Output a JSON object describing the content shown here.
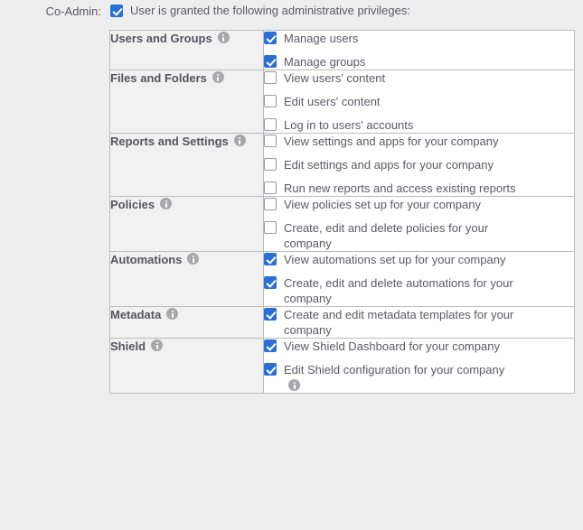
{
  "form": {
    "field_label": "Co-Admin:",
    "master_checkbox": {
      "label": "User is granted the following administrative privileges:",
      "checked": true,
      "icon": "checkbox-checked-icon"
    }
  },
  "icons": {
    "info": "info-icon",
    "checked": "checkbox-checked-icon",
    "unchecked": "checkbox-unchecked-icon"
  },
  "colors": {
    "page_background": "#eeeeee",
    "checkbox_accent": "#2a6fd4",
    "text": "#5a5a64",
    "category_background": "#f1f1f1",
    "border": "#bcbcc0",
    "info_icon": "#a8a8ac"
  },
  "privileges_table": {
    "rows": [
      {
        "category": "Users and Groups",
        "has_info": true,
        "permissions": [
          {
            "label": "Manage users",
            "checked": true,
            "trailing_info": false
          },
          {
            "label": "Manage groups",
            "checked": true,
            "trailing_info": false
          }
        ]
      },
      {
        "category": "Files and Folders",
        "has_info": true,
        "permissions": [
          {
            "label": "View users' content",
            "checked": false,
            "trailing_info": false
          },
          {
            "label": "Edit users' content",
            "checked": false,
            "trailing_info": false
          },
          {
            "label": "Log in to users' accounts",
            "checked": false,
            "trailing_info": false
          }
        ]
      },
      {
        "category": "Reports and Settings",
        "has_info": true,
        "permissions": [
          {
            "label": "View settings and apps for your company",
            "checked": false,
            "trailing_info": false
          },
          {
            "label": "Edit settings and apps for your company",
            "checked": false,
            "trailing_info": false
          },
          {
            "label": "Run new reports and access existing reports",
            "checked": false,
            "trailing_info": false
          }
        ]
      },
      {
        "category": "Policies",
        "has_info": true,
        "permissions": [
          {
            "label": "View policies set up for your company",
            "checked": false,
            "trailing_info": false
          },
          {
            "label": "Create, edit and delete policies for your company",
            "checked": false,
            "trailing_info": false
          }
        ]
      },
      {
        "category": "Automations",
        "has_info": true,
        "permissions": [
          {
            "label": "View automations set up for your company",
            "checked": true,
            "trailing_info": false
          },
          {
            "label": "Create, edit and delete automations for your company",
            "checked": true,
            "trailing_info": false
          }
        ]
      },
      {
        "category": "Metadata",
        "has_info": true,
        "permissions": [
          {
            "label": "Create and edit metadata templates for your company",
            "checked": true,
            "trailing_info": false
          }
        ]
      },
      {
        "category": "Shield",
        "has_info": true,
        "permissions": [
          {
            "label": "View Shield Dashboard for your company",
            "checked": true,
            "trailing_info": false
          },
          {
            "label": "Edit Shield configuration for your company",
            "checked": true,
            "trailing_info": true
          }
        ]
      }
    ]
  }
}
